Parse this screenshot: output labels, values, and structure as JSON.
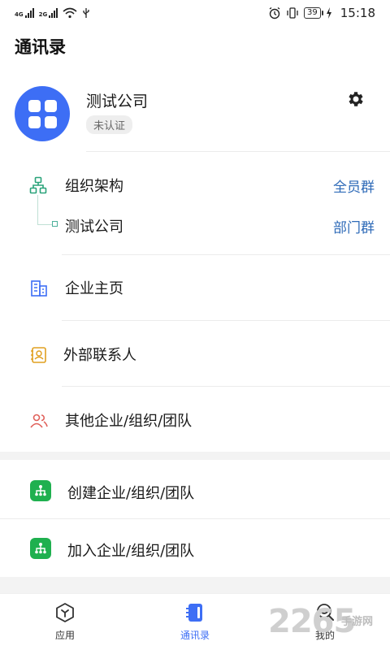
{
  "status_bar": {
    "net1": "4G",
    "net2": "2G",
    "battery": "39",
    "time": "15:18"
  },
  "header": {
    "title": "通讯录"
  },
  "company": {
    "name": "测试公司",
    "badge": "未认证"
  },
  "org": {
    "label": "组织架构",
    "all_group": "全员群",
    "child_label": "测试公司",
    "dept_group": "部门群"
  },
  "menu": [
    {
      "label": "企业主页",
      "icon": "building-icon"
    },
    {
      "label": "外部联系人",
      "icon": "contact-card-icon"
    },
    {
      "label": "其他企业/组织/团队",
      "icon": "people-icon"
    }
  ],
  "actions": [
    {
      "label": "创建企业/组织/团队",
      "icon": "org-tree-icon"
    },
    {
      "label": "加入企业/组织/团队",
      "icon": "org-tree-icon"
    }
  ],
  "bottom_nav": [
    {
      "label": "应用",
      "icon": "apps-icon"
    },
    {
      "label": "通讯录",
      "icon": "address-book-icon",
      "active": true
    },
    {
      "label": "我的",
      "icon": "profile-icon"
    }
  ],
  "watermark": {
    "number": "2265",
    "text": "手游网"
  },
  "colors": {
    "accent": "#3d6ef5",
    "link": "#2f6bb8",
    "green": "#1fb04f",
    "org_icon": "#2aa37a"
  }
}
